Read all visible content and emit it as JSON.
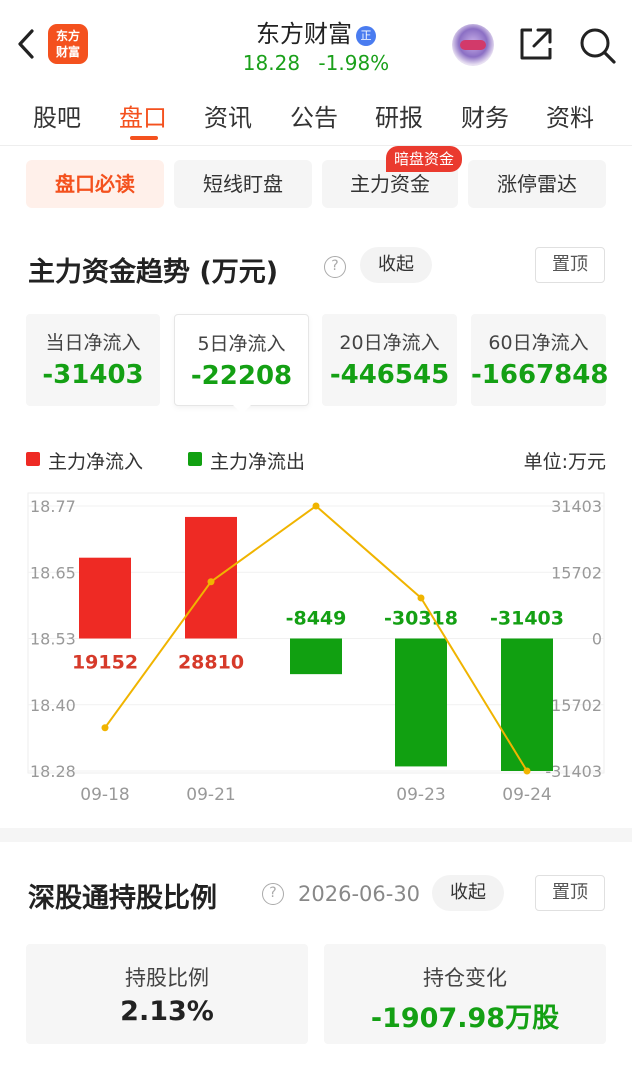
{
  "header": {
    "logo_line1": "东方",
    "logo_line2": "财富",
    "stock_name": "东方财富",
    "badge": "正",
    "price": "18.28",
    "change_pct": "-1.98%",
    "quote_color": "#1aa01a"
  },
  "tabs": [
    "股吧",
    "盘口",
    "资讯",
    "公告",
    "研报",
    "财务",
    "资料"
  ],
  "active_tab": "盘口",
  "subtabs": [
    "盘口必读",
    "短线盯盘",
    "主力资金",
    "涨停雷达"
  ],
  "subtab_badge": "暗盘资金",
  "fund_section": {
    "title": "主力资金趋势 (万元)",
    "help": "?",
    "collapse": "收起",
    "pin": "置顶",
    "cards": [
      {
        "label": "当日净流入",
        "value": "-31403"
      },
      {
        "label": "5日净流入",
        "value": "-22208"
      },
      {
        "label": "20日净流入",
        "value": "-446545"
      },
      {
        "label": "60日净流入",
        "value": "-1667848"
      }
    ],
    "legend_in": "主力净流入",
    "legend_out": "主力净流出",
    "unit": "单位:万元"
  },
  "colors": {
    "inflow": "#ee2a24",
    "outflow": "#11a011",
    "price_line": "#f0b400",
    "accent": "#f4511e"
  },
  "chart_data": {
    "type": "bar",
    "categories": [
      "09-18",
      "09-21",
      "",
      "09-23",
      "09-24"
    ],
    "series": [
      {
        "name": "主力净流入/流出",
        "values": [
          19152,
          28810,
          -8449,
          -30318,
          -31403
        ]
      },
      {
        "name": "price",
        "values": [
          18.36,
          18.63,
          18.77,
          18.6,
          18.28
        ]
      }
    ],
    "bar_labels": [
      "19152",
      "28810",
      "-8449",
      "-30318",
      "-31403"
    ],
    "left_ticks": [
      "18.77",
      "18.65",
      "18.53",
      "18.40",
      "18.28"
    ],
    "right_ticks": [
      "31403",
      "15702",
      "0",
      "-15702",
      "-31403"
    ],
    "ylim_left": [
      18.28,
      18.77
    ],
    "ylim_right": [
      -31403,
      31403
    ]
  },
  "holding_section": {
    "title": "深股通持股比例",
    "help": "?",
    "date": "2026-06-30",
    "collapse": "收起",
    "pin": "置顶",
    "ratio_label": "持股比例",
    "ratio_value": "2.13%",
    "change_label": "持仓变化",
    "change_value": "-1907.98万股"
  }
}
